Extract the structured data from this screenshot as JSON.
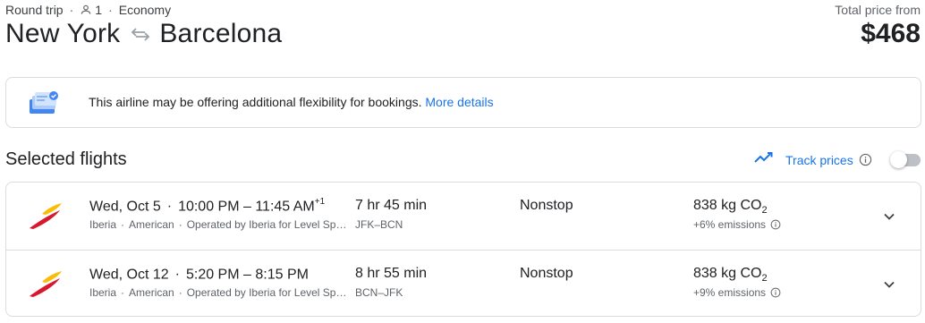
{
  "trip": {
    "type": "Round trip",
    "passengers": "1",
    "cabin": "Economy",
    "origin": "New York",
    "destination": "Barcelona"
  },
  "price": {
    "label": "Total price from",
    "value": "$468"
  },
  "notice": {
    "text": "This airline may be offering additional flexibility for bookings.",
    "link": "More details"
  },
  "selected": {
    "title": "Selected flights",
    "track_label": "Track prices",
    "track_enabled": false
  },
  "flights": [
    {
      "date": "Wed, Oct 5",
      "depart": "10:00 PM",
      "arrive": "11:45 AM",
      "day_offset": "+1",
      "carriers": [
        "Iberia",
        "American",
        "Operated by Iberia for Level Sp…"
      ],
      "duration": "7 hr 45 min",
      "airports": "JFK–BCN",
      "stops": "Nonstop",
      "co2_value": "838 kg CO",
      "co2_sub": "2",
      "emissions": "+6% emissions"
    },
    {
      "date": "Wed, Oct 12",
      "depart": "5:20 PM",
      "arrive": "8:15 PM",
      "day_offset": "",
      "carriers": [
        "Iberia",
        "American",
        "Operated by Iberia for Level Sp…"
      ],
      "duration": "8 hr 55 min",
      "airports": "BCN–JFK",
      "stops": "Nonstop",
      "co2_value": "838 kg CO",
      "co2_sub": "2",
      "emissions": "+9% emissions"
    }
  ],
  "colors": {
    "link": "#1a73e8",
    "border": "#dadce0",
    "muted": "#5f6368",
    "iberia_red": "#d7192d",
    "iberia_yellow": "#fbbc05"
  }
}
